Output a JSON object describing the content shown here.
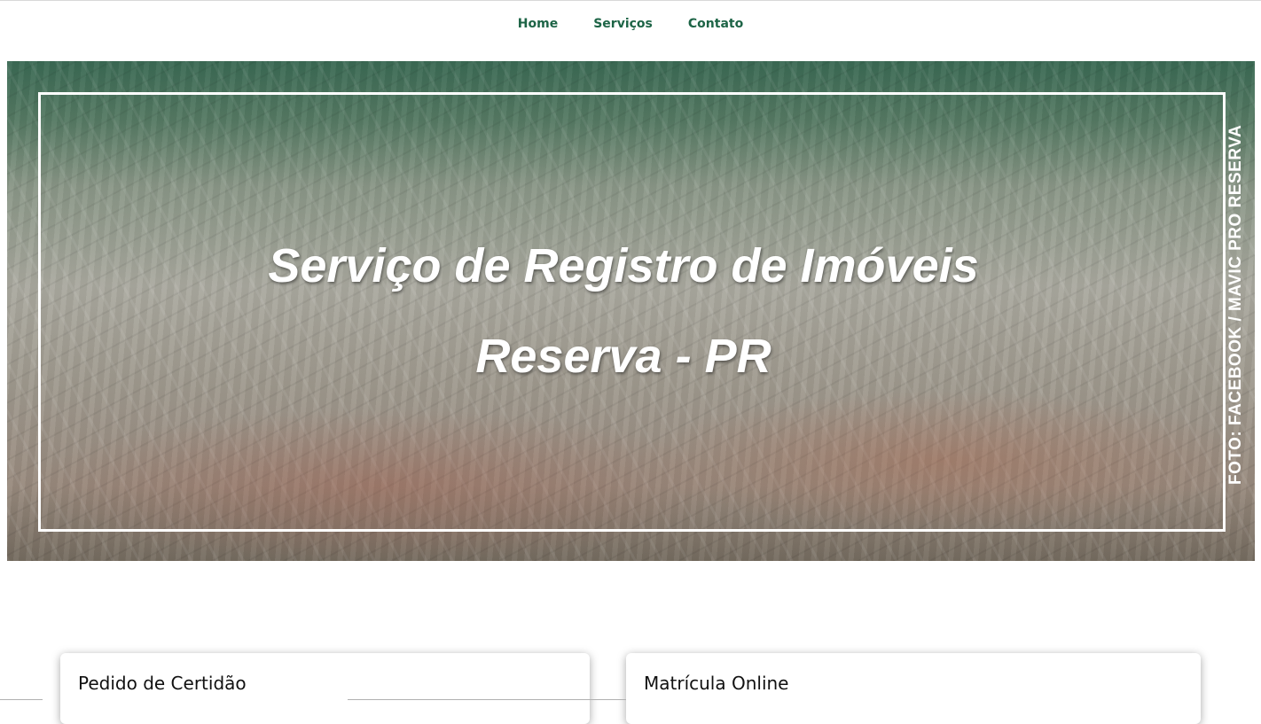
{
  "nav": {
    "items": [
      {
        "label": "Home"
      },
      {
        "label": "Serviços"
      },
      {
        "label": "Contato"
      }
    ]
  },
  "hero": {
    "title_line1": "Serviço de Registro de Imóveis",
    "title_line2": "Reserva - PR",
    "photo_credit": "FOTO: FACEBOOK / MAVIC PRO RESERVA"
  },
  "cards": [
    {
      "title": "Pedido de Certidão"
    },
    {
      "title": "Matrícula Online"
    }
  ],
  "colors": {
    "nav_text": "#1d6446",
    "hero_text": "#ffffff",
    "card_bg": "#ffffff"
  }
}
